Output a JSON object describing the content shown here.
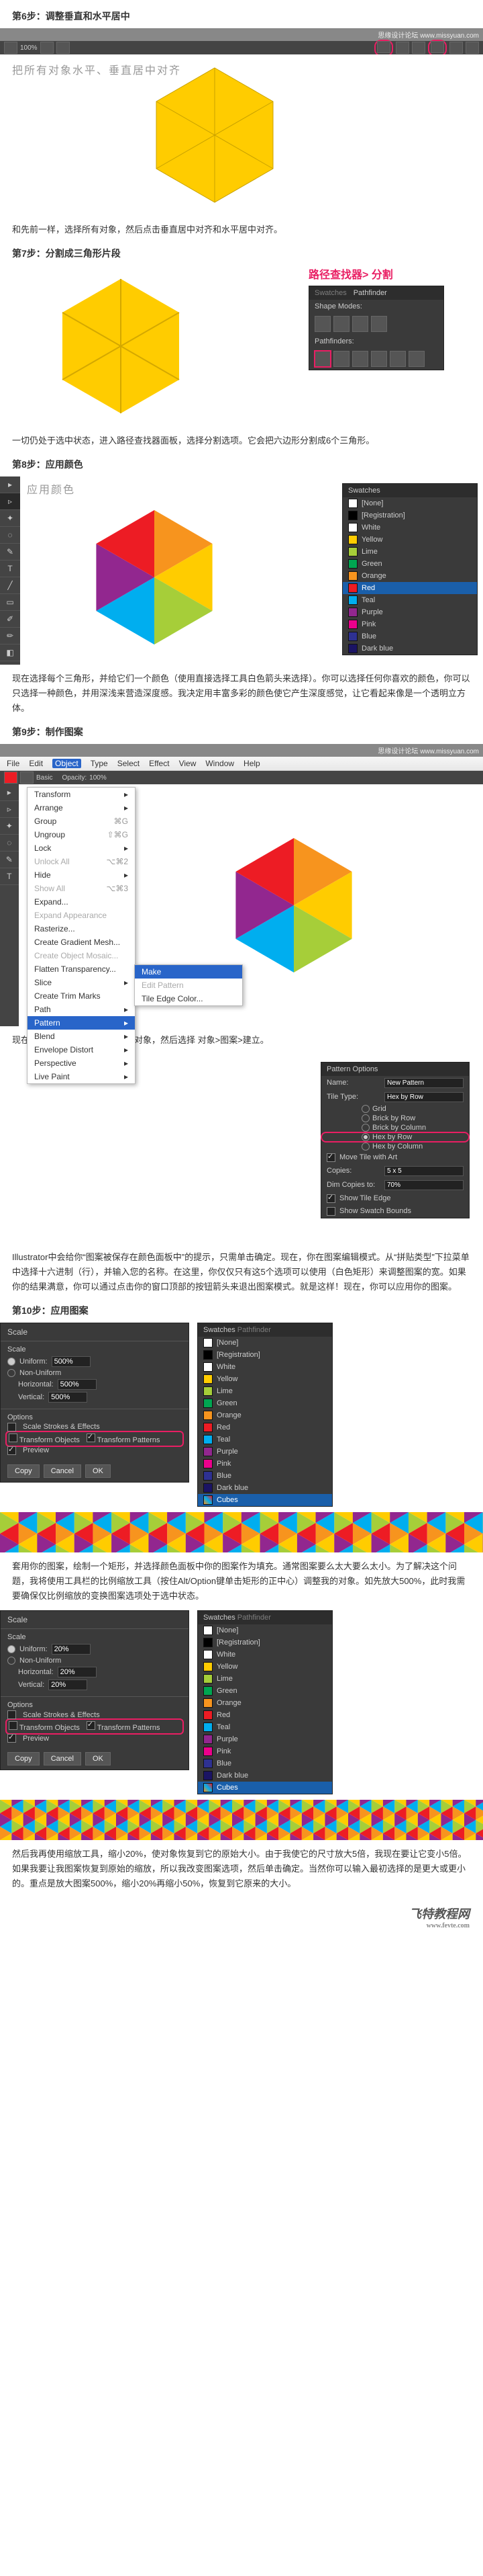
{
  "header_brand": "思缘设计论坛  www.missyuan.com",
  "steps": {
    "s6": {
      "title": "第6步：调整垂直和水平居中",
      "caption": "把所有对象水平、垂直居中对齐",
      "body": "和先前一样，选择所有对象，然后点击垂直居中对齐和水平居中对齐。"
    },
    "s7": {
      "title": "第7步：分割成三角形片段",
      "anno": "路径查找器> 分割",
      "pathfinder": {
        "tab": "Pathfinder",
        "label1": "Shape Modes:",
        "label2": "Pathfinders:"
      },
      "body": "一切仍处于选中状态，进入路径查找器面板，选择分割选项。它会把六边形分割成6个三角形。"
    },
    "s8": {
      "title": "第8步：应用颜色",
      "caption": "应用颜色",
      "swatches": {
        "tab": "Swatches",
        "items": [
          {
            "name": "[None]",
            "color": "transparent"
          },
          {
            "name": "[Registration]",
            "color": "#000"
          },
          {
            "name": "White",
            "color": "#fff"
          },
          {
            "name": "Yellow",
            "color": "#ffcc00"
          },
          {
            "name": "Lime",
            "color": "#a6ce39"
          },
          {
            "name": "Green",
            "color": "#00a651"
          },
          {
            "name": "Orange",
            "color": "#f7941e"
          },
          {
            "name": "Red",
            "color": "#ed1c24"
          },
          {
            "name": "Teal",
            "color": "#00aeef"
          },
          {
            "name": "Purple",
            "color": "#92278f"
          },
          {
            "name": "Pink",
            "color": "#ec008c"
          },
          {
            "name": "Blue",
            "color": "#2e3192"
          },
          {
            "name": "Dark blue",
            "color": "#1b1464"
          }
        ],
        "highlight": "Red"
      },
      "body": "现在选择每个三角形，并给它们一个颜色（使用直接选择工具白色箭头来选择）。你可以选择任何你喜欢的颜色，你可以只选择一种颜色，并用深浅来营造深度感。我决定用丰富多彩的颜色使它产生深度感觉，让它看起来像是一个透明立方体。"
    },
    "s9": {
      "title": "第9步：制作图案",
      "menus": [
        "File",
        "Edit",
        "Object",
        "Type",
        "Select",
        "Effect",
        "View",
        "Window",
        "Help"
      ],
      "opacity_label": "Opacity:",
      "opacity_val": "100%",
      "dropdown": [
        {
          "t": "Transform",
          "arrow": true
        },
        {
          "t": "Arrange",
          "arrow": true
        },
        {
          "t": "Group",
          "k": "⌘G"
        },
        {
          "t": "Ungroup",
          "k": "⇧⌘G"
        },
        {
          "t": "Lock",
          "arrow": true
        },
        {
          "t": "Unlock All",
          "k": "⌥⌘2",
          "dis": true
        },
        {
          "t": "Hide",
          "arrow": true
        },
        {
          "t": "Show All",
          "k": "⌥⌘3",
          "dis": true
        },
        {
          "t": "Expand..."
        },
        {
          "t": "Expand Appearance",
          "dis": true
        },
        {
          "t": "Rasterize..."
        },
        {
          "t": "Create Gradient Mesh..."
        },
        {
          "t": "Create Object Mosaic...",
          "dis": true
        },
        {
          "t": "Flatten Transparency..."
        },
        {
          "t": "Slice",
          "arrow": true
        },
        {
          "t": "Create Trim Marks"
        },
        {
          "t": "Path",
          "arrow": true
        },
        {
          "t": "Pattern",
          "arrow": true,
          "hl": true
        },
        {
          "t": "Blend",
          "arrow": true
        },
        {
          "t": "Envelope Distort",
          "arrow": true
        },
        {
          "t": "Perspective",
          "arrow": true
        },
        {
          "t": "Live Paint",
          "arrow": true
        }
      ],
      "submenu": [
        {
          "t": "Make",
          "hl": true
        },
        {
          "t": "Edit Pattern",
          "dis": true
        },
        {
          "t": "Tile Edge Color..."
        }
      ],
      "body1": "现在到了有趣的部分！选择整个对象，然后选择  对象>图案>建立。",
      "pattern_opts": {
        "title": "Pattern Options",
        "name_lbl": "Name:",
        "name_val": "New Pattern",
        "tile_lbl": "Tile Type:",
        "tile_val": "Hex by Row",
        "radios": [
          "Grid",
          "Brick by Row",
          "Brick by Column",
          "Hex by Row",
          "Hex by Column"
        ],
        "radio_sel": "Hex by Row",
        "move_lbl": "Move Tile with Art",
        "copies_lbl": "Copies:",
        "copies_val": "5 x 5",
        "dim_lbl": "Dim Copies to:",
        "dim_val": "70%",
        "show_tile": "Show Tile Edge",
        "show_swatch": "Show Swatch Bounds"
      },
      "body2": "Illustrator中会给你“图案被保存在颜色面板中”的提示，只需单击确定。现在，你在图案编辑模式。从“拼贴类型”下拉菜单中选择十六进制（行），并输入您的名称。在这里，你仅仅只有这5个选项可以使用（白色矩形）来调整图案的宽。如果你的结果满意，你可以通过点击你的窗口顶部的按钮箭头来退出图案模式。就是这样！现在，你可以应用你的图案。"
    },
    "s10": {
      "title": "第10步：应用图案",
      "scale1": {
        "title": "Scale",
        "uniform": "Uniform:",
        "uniform_v": "500%",
        "nonuniform": "Non-Uniform",
        "horiz": "Horizontal:",
        "horiz_v": "500%",
        "vert": "Vertical:",
        "vert_v": "500%",
        "opts": "Options",
        "o1": "Scale Strokes & Effects",
        "o2": "Transform Objects",
        "o3": "Transform Patterns",
        "preview": "Preview",
        "btns": [
          "Copy",
          "Cancel",
          "OK"
        ]
      },
      "swatches2": {
        "items": [
          {
            "name": "[None]",
            "color": "transparent"
          },
          {
            "name": "[Registration]",
            "color": "#000"
          },
          {
            "name": "White",
            "color": "#fff"
          },
          {
            "name": "Yellow",
            "color": "#ffcc00"
          },
          {
            "name": "Lime",
            "color": "#a6ce39"
          },
          {
            "name": "Green",
            "color": "#00a651"
          },
          {
            "name": "Orange",
            "color": "#f7941e"
          },
          {
            "name": "Red",
            "color": "#ed1c24"
          },
          {
            "name": "Teal",
            "color": "#00aeef"
          },
          {
            "name": "Purple",
            "color": "#92278f"
          },
          {
            "name": "Pink",
            "color": "#ec008c"
          },
          {
            "name": "Blue",
            "color": "#2e3192"
          },
          {
            "name": "Dark blue",
            "color": "#1b1464"
          },
          {
            "name": "Cubes",
            "color": "pattern"
          }
        ],
        "highlight": "Cubes"
      },
      "body1": "套用你的图案，绘制一个矩形，并选择颜色面板中你的图案作为填充。通常图案要么太大要么太小。为了解决这个问题，我将使用工具栏的比例缩放工具（按住Alt/Option键单击矩形的正中心）调整我的对象。如先放大500%，此时我需要确保仅比例缩放的变换图案选项处于选中状态。",
      "scale2": {
        "uniform_v": "20%",
        "horiz_v": "20%",
        "vert_v": "20%"
      },
      "body2": "然后我再使用缩放工具，缩小20%，使对象恢复到它的原始大小。由于我使它的尺寸放大5倍，我现在要让它变小5倍。如果我要让我图案恢复到原始的缩放，所以我改变图案选项，然后单击确定。当然你可以输入最初选择的是更大或更小的。重点是放大图案500%，缩小20%再缩小50%，恢复到它原来的大小。"
    }
  },
  "hex_colors": [
    "#f7941e",
    "#ffcc00",
    "#a6ce39",
    "#00aeef",
    "#92278f",
    "#ed1c24"
  ],
  "footer": {
    "main": "飞特教程网",
    "sub": "www.fevte.com"
  }
}
